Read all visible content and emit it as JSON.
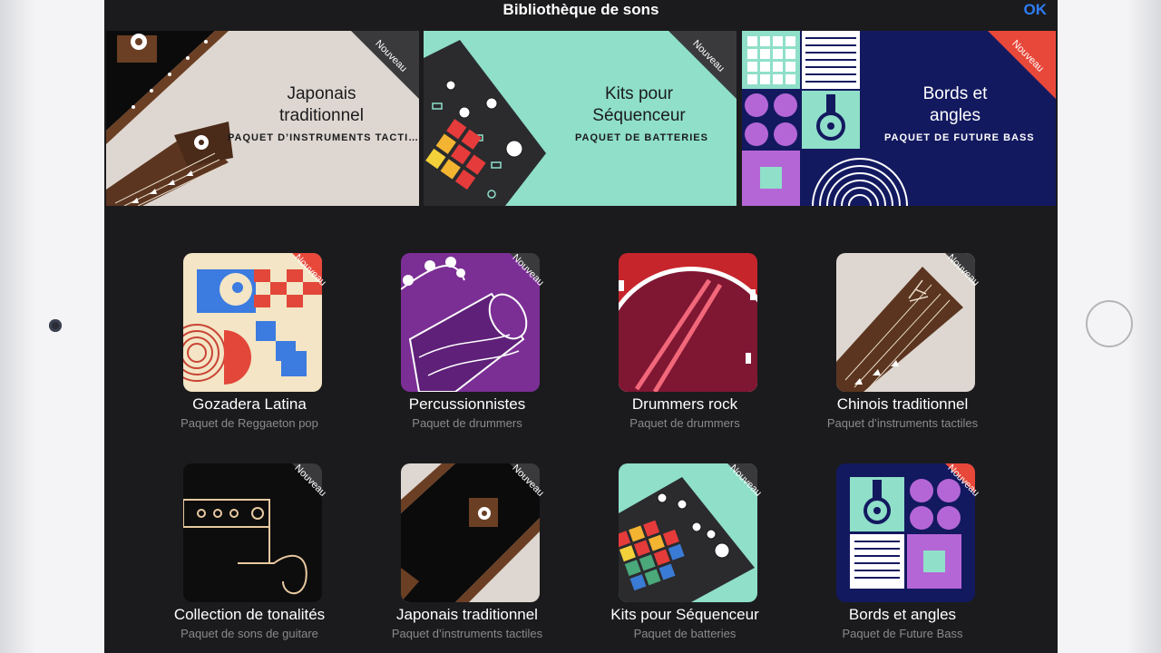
{
  "nav": {
    "title": "Bibliothèque de sons",
    "ok_label": "OK"
  },
  "badge_label": "Nouveau",
  "banners": [
    {
      "title_line1": "Japonais",
      "title_line2": "traditionnel",
      "subtitle": "PAQUET D’INSTRUMENTS TACTI…"
    },
    {
      "title_line1": "Kits pour",
      "title_line2": "Séquenceur",
      "subtitle": "PAQUET DE BATTERIES"
    },
    {
      "title_line1": "Bords et",
      "title_line2": "angles",
      "subtitle": "PAQUET DE FUTURE BASS"
    }
  ],
  "tiles": [
    {
      "name": "Gozadera Latina",
      "subtitle": "Paquet de Reggaeton pop"
    },
    {
      "name": "Percussionnistes",
      "subtitle": "Paquet de drummers"
    },
    {
      "name": "Drummers rock",
      "subtitle": "Paquet de drummers"
    },
    {
      "name": "Chinois traditionnel",
      "subtitle": "Paquet d’instruments tactiles"
    },
    {
      "name": "Collection de tonalités",
      "subtitle": "Paquet de sons de guitare"
    },
    {
      "name": "Japonais traditionnel",
      "subtitle": "Paquet d’instruments tactiles"
    },
    {
      "name": "Kits pour Séquenceur",
      "subtitle": "Paquet de batteries"
    },
    {
      "name": "Bords et angles",
      "subtitle": "Paquet de Future Bass"
    }
  ],
  "colors": {
    "accent": "#2f7cf6",
    "screen_bg": "#1b1b1d",
    "badge_dark": "#3a3a3c",
    "badge_red": "#e8483a"
  }
}
